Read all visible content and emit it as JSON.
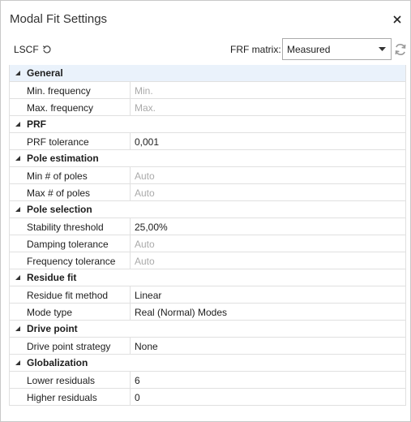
{
  "window": {
    "title": "Modal Fit Settings"
  },
  "toolbar": {
    "method_label": "LSCF",
    "frf_label": "FRF matrix:",
    "frf_selected": "Measured"
  },
  "categories": [
    {
      "label": "General",
      "selected": true,
      "props": [
        {
          "name": "Min. frequency",
          "value": "Min.",
          "placeholder": true
        },
        {
          "name": "Max. frequency",
          "value": "Max.",
          "placeholder": true
        }
      ]
    },
    {
      "label": "PRF",
      "props": [
        {
          "name": "PRF tolerance",
          "value": "0,001",
          "placeholder": false
        }
      ]
    },
    {
      "label": "Pole estimation",
      "props": [
        {
          "name": "Min # of poles",
          "value": "Auto",
          "placeholder": true
        },
        {
          "name": "Max # of poles",
          "value": "Auto",
          "placeholder": true
        }
      ]
    },
    {
      "label": "Pole selection",
      "props": [
        {
          "name": "Stability threshold",
          "value": "25,00%",
          "placeholder": false
        },
        {
          "name": "Damping tolerance",
          "value": "Auto",
          "placeholder": true
        },
        {
          "name": "Frequency tolerance",
          "value": "Auto",
          "placeholder": true
        }
      ]
    },
    {
      "label": "Residue fit",
      "props": [
        {
          "name": "Residue fit method",
          "value": "Linear",
          "placeholder": false
        },
        {
          "name": "Mode type",
          "value": "Real (Normal) Modes",
          "placeholder": false
        }
      ]
    },
    {
      "label": "Drive point",
      "props": [
        {
          "name": "Drive point strategy",
          "value": "None",
          "placeholder": false
        }
      ]
    },
    {
      "label": "Globalization",
      "props": [
        {
          "name": "Lower residuals",
          "value": "6",
          "placeholder": false
        },
        {
          "name": "Higher residuals",
          "value": "0",
          "placeholder": false
        }
      ]
    }
  ],
  "colors": {
    "selected_row": "#eaf2fb",
    "grid_line": "#e0e0e0",
    "placeholder_text": "#aaaaaa"
  },
  "icons": {
    "close": "close-icon",
    "reset": "reset-icon",
    "dropdown": "chevron-down-icon",
    "refresh": "refresh-icon",
    "collapse": "collapse-triangle-icon"
  }
}
